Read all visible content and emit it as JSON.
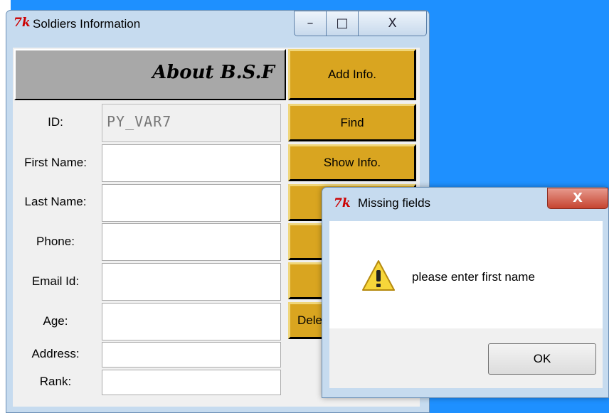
{
  "main_window": {
    "title": "Soldiers Information",
    "logo": "7k",
    "about_label": "About B.S.F",
    "buttons": {
      "add": "Add Info.",
      "find": "Find",
      "show": "Show Info.",
      "delete": "Dele"
    },
    "fields": [
      {
        "label": "ID:",
        "value": "PY_VAR7"
      },
      {
        "label": "First Name:",
        "value": ""
      },
      {
        "label": "Last Name:",
        "value": ""
      },
      {
        "label": "Phone:",
        "value": ""
      },
      {
        "label": "Email Id:",
        "value": ""
      },
      {
        "label": "Age:",
        "value": ""
      },
      {
        "label": "Address:",
        "value": ""
      },
      {
        "label": "Rank:",
        "value": ""
      }
    ],
    "controls": {
      "minimize": "–",
      "maximize": "□",
      "close": "X"
    }
  },
  "dialog": {
    "title": "Missing fields",
    "message": "please enter first name",
    "ok_label": "OK",
    "icon": "warning-icon",
    "close": "X"
  },
  "colors": {
    "gold_button": "#d9a520",
    "about_bar": "#a8a8a8",
    "desktop": "#1e90ff",
    "chrome": "#c6dbef"
  }
}
